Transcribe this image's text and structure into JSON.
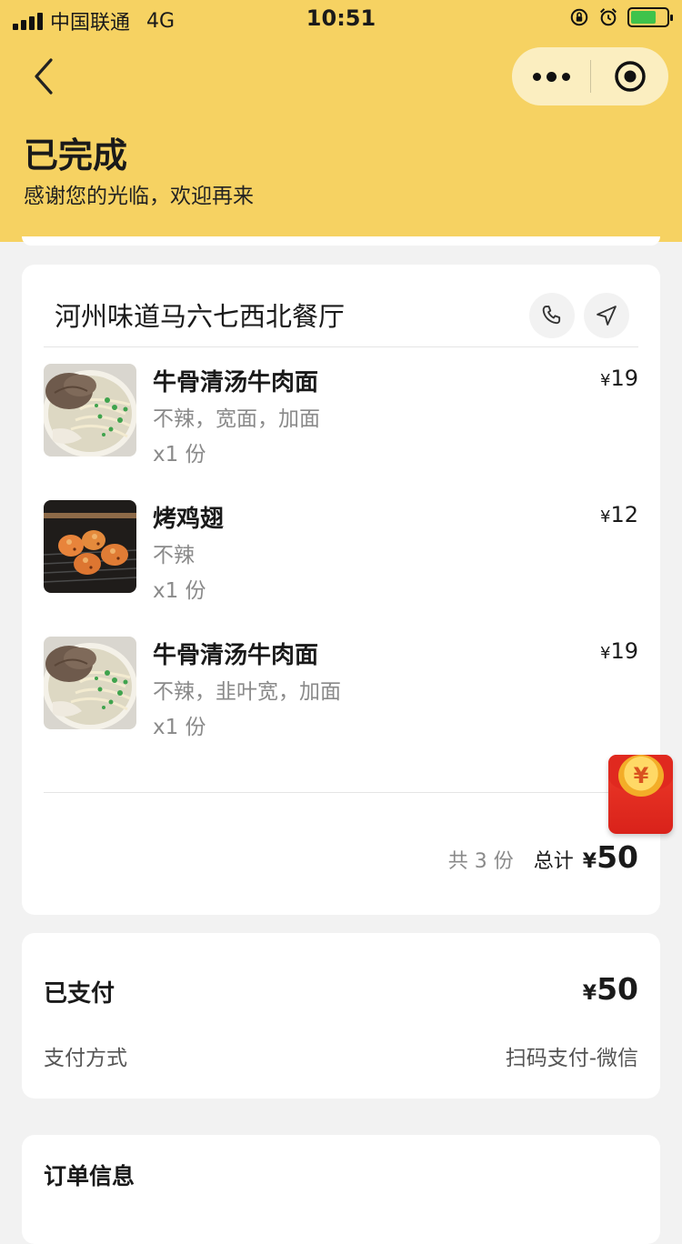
{
  "status_bar": {
    "carrier": "中国联通",
    "network": "4G",
    "time": "10:51"
  },
  "header": {
    "status_title": "已完成",
    "status_subtitle": "感谢您的光临，欢迎再来"
  },
  "order": {
    "shop_name": "河州味道马六七西北餐厅",
    "currency_symbol": "¥",
    "items": [
      {
        "name": "牛骨清汤牛肉面",
        "options": "不辣，宽面，加面",
        "quantity": "x1 份",
        "price": "19",
        "image": "beef-noodle-image"
      },
      {
        "name": "烤鸡翅",
        "options": "不辣",
        "quantity": "x1 份",
        "price": "12",
        "image": "grilled-wings-image"
      },
      {
        "name": "牛骨清汤牛肉面",
        "options": "不辣，韭叶宽，加面",
        "quantity": "x1 份",
        "price": "19",
        "image": "beef-noodle-image"
      }
    ],
    "count_text": "共 3 份",
    "total_label": "总计",
    "total_amount": "50"
  },
  "payment": {
    "paid_label": "已支付",
    "paid_amount": "50",
    "method_label": "支付方式",
    "method_value": "扫码支付-微信"
  },
  "info": {
    "title": "订单信息"
  },
  "red_packet": {
    "coin_symbol": "¥"
  },
  "colors": {
    "header_bg": "#f6d262",
    "capsule_bg": "#fbeec0",
    "page_bg": "#f2f2f2",
    "muted_text": "#8a8a8a",
    "red_packet": "#e0291f"
  }
}
